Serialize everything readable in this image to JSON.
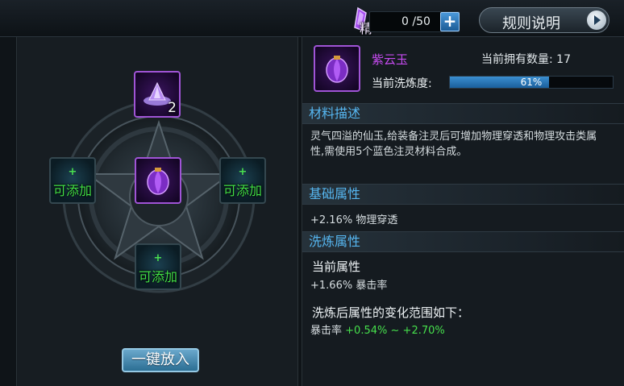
{
  "topbar": {
    "essence_char": "精",
    "essence_value": "0 /50",
    "plus_symbol": "+",
    "rules_label": "规则说明"
  },
  "wheel": {
    "top_slot_count": "2",
    "empty_slot_plus": "+",
    "empty_slot_label": "可添加"
  },
  "left": {
    "one_key_label": "一键放入"
  },
  "item": {
    "name": "紫云玉",
    "owned_label": "当前拥有数量: 17",
    "refine_label": "当前洗炼度:",
    "refine_percent": 61,
    "refine_text": "61%"
  },
  "sections": {
    "material_title": "材料描述",
    "material_desc": "灵气四溢的仙玉,给装备注灵后可增加物理穿透和物理攻击类属性,需使用5个蓝色注灵材料合成。",
    "base_title": "基础属性",
    "base_stat": "+2.16% 物理穿透",
    "refine_title": "洗炼属性",
    "current_attr_title": "当前属性",
    "current_attr_value": "+1.66% 暴击率",
    "range_title": "洗炼后属性的变化范围如下：",
    "range_stat": "暴击率",
    "range_min": "+0.54%",
    "range_sep": "~",
    "range_max": "+2.70%"
  },
  "colors": {
    "accent_blue": "#56b6f0",
    "item_purple": "#c64bf0",
    "positive_green": "#46e04c"
  }
}
